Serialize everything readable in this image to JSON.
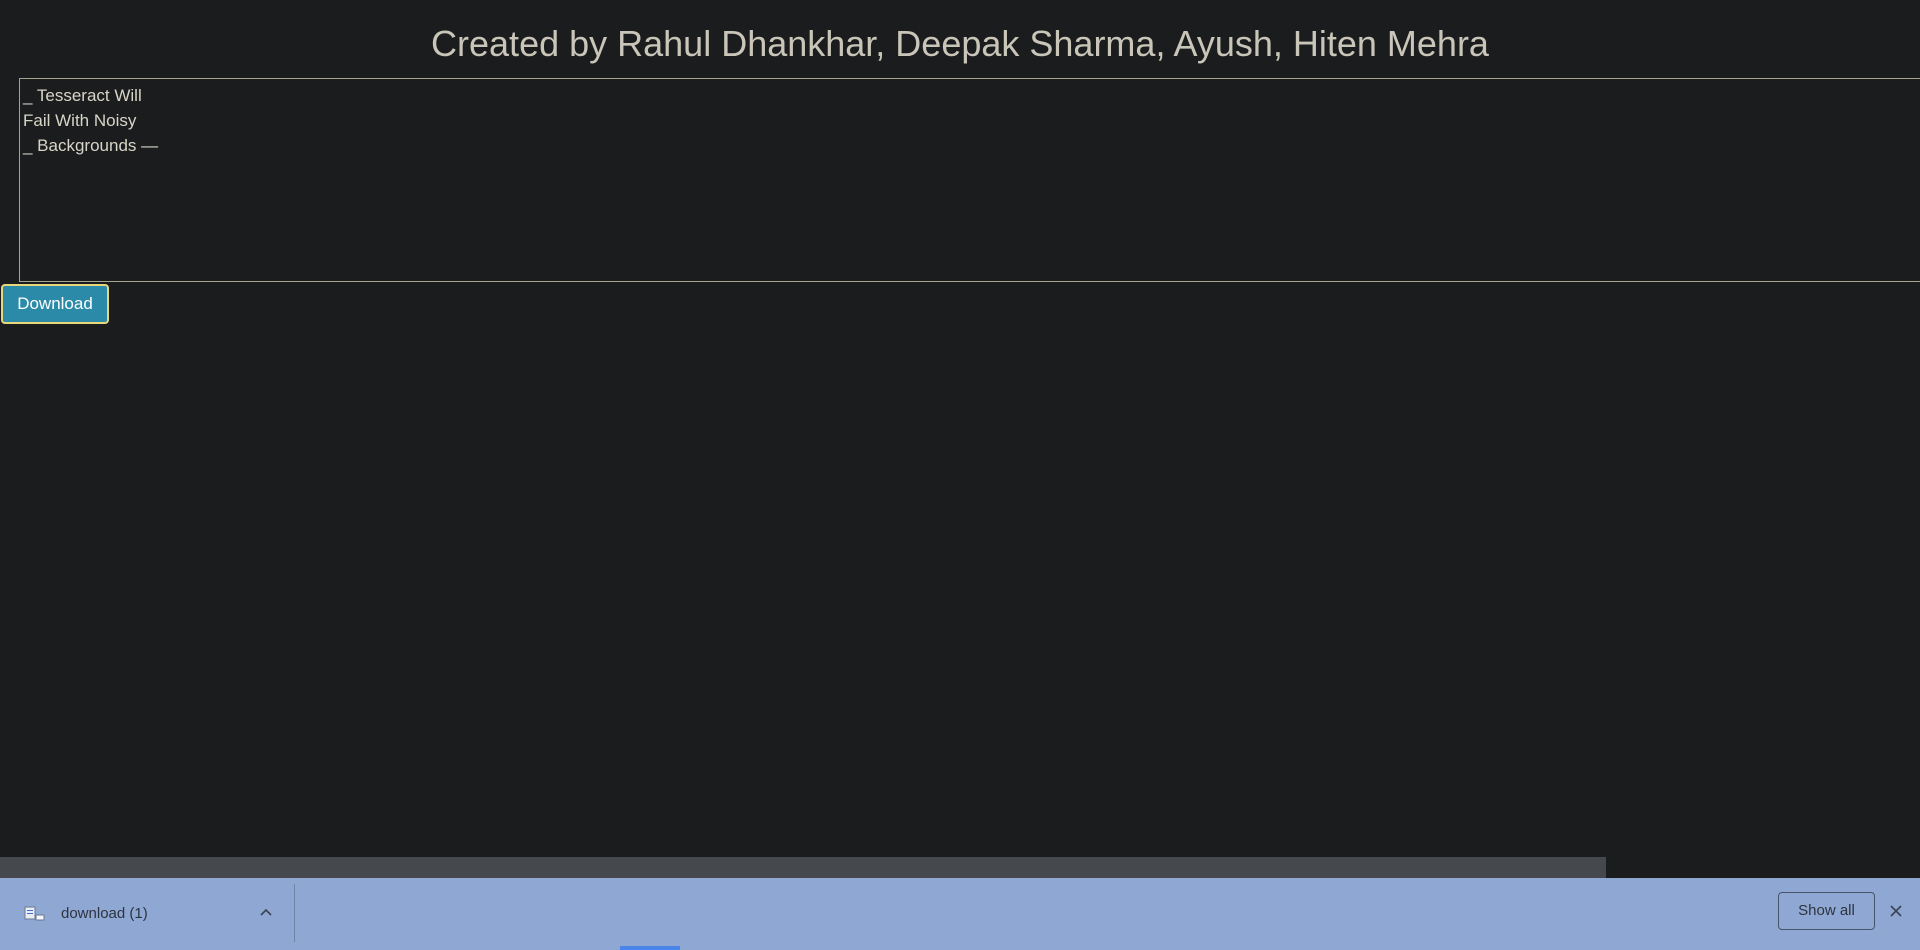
{
  "header": {
    "title": "Created by Rahul Dhankhar, Deepak Sharma, Ayush, Hiten Mehra"
  },
  "output": {
    "text": "_ Tesseract Will\nFail With Noisy\n_ Backgrounds —"
  },
  "actions": {
    "download_label": "Download"
  },
  "download_shelf": {
    "file_name": "download (1)",
    "file_icon": "file-icon",
    "show_all_label": "Show all",
    "close_icon": "close-icon",
    "background": "#8fa8d3"
  },
  "colors": {
    "page_background": "#1b1c1e",
    "button_background": "#2a8aa8",
    "button_border": "#e8d67a",
    "title_text": "#c9c5b9"
  }
}
